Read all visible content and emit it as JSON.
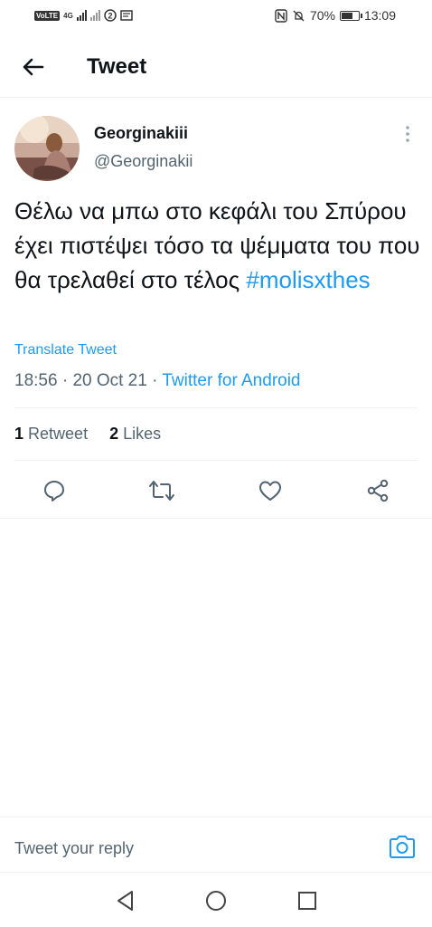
{
  "status_bar": {
    "network": "VoLTE",
    "network_type": "4G",
    "battery_percent": "70%",
    "battery_level": 0.7,
    "time": "13:09"
  },
  "header": {
    "title": "Tweet",
    "back_icon": "arrow-left-icon"
  },
  "tweet": {
    "author_name": "Georginakiii",
    "author_handle": "@Georginakii",
    "text": "Θέλω να μπω στο κεφάλι του Σπύρου έχει πιστέψει τόσο τα ψέμματα του που θα τρελαθεί στο τέλος ",
    "hashtag": "#molisxthes",
    "translate_label": "Translate Tweet",
    "time": "18:56",
    "date": "20 Oct 21",
    "source": "Twitter for Android",
    "retweet_count": "1",
    "retweet_label": "Retweet",
    "likes_count": "2",
    "likes_label": "Likes"
  },
  "actions": [
    "reply-icon",
    "retweet-icon",
    "like-icon",
    "share-icon"
  ],
  "reply_bar": {
    "placeholder": "Tweet your reply",
    "camera_icon": "camera-icon"
  },
  "nav_bar": [
    "back-triangle-icon",
    "home-circle-icon",
    "recents-square-icon"
  ],
  "colors": {
    "accent": "#1d9bf0",
    "text": "#0f1419",
    "secondary": "#536471",
    "divider": "#eff3f4"
  }
}
